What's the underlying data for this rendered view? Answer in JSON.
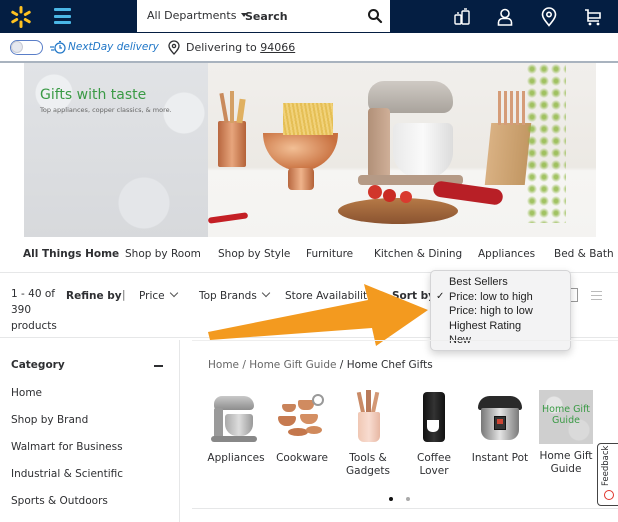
{
  "header": {
    "logo": "walmart-spark-icon",
    "menu_icon": "hamburger-menu-icon",
    "departments_label": "All Departments",
    "search_placeholder": "Search",
    "search_icon": "search-icon",
    "icons": [
      "reorder-icon",
      "account-icon",
      "store-locator-icon",
      "cart-icon"
    ],
    "colors": {
      "bar": "#041e42",
      "spark": "#ffc220",
      "menu": "#4bb7e6"
    }
  },
  "delivery": {
    "toggle_on": false,
    "nextday_label": "NextDay delivery",
    "delivering_label": "Delivering to",
    "zip": "94066"
  },
  "hero": {
    "title": "Gifts with taste",
    "subtitle": "Top appliances, copper classics, & more."
  },
  "category_nav": {
    "items": [
      {
        "label": "All Things Home",
        "active": true
      },
      {
        "label": "Shop by Room",
        "active": false
      },
      {
        "label": "Shop by Style",
        "active": false
      },
      {
        "label": "Furniture",
        "active": false
      },
      {
        "label": "Kitchen & Dining",
        "active": false
      },
      {
        "label": "Appliances",
        "active": false
      },
      {
        "label": "Bed & Bath",
        "active": false
      }
    ]
  },
  "refine": {
    "count_line1": "1 - 40 of",
    "count_line2": "390",
    "count_line3": "products",
    "refine_by": "Refine by",
    "separator": "|",
    "filters": [
      "Price",
      "Top Brands",
      "Store Availability"
    ],
    "sort_by": "Sort by"
  },
  "sort_dropdown": {
    "selected": "Price: low to high",
    "options": [
      "Best Sellers",
      "Price: low to high",
      "Price: high to low",
      "Highest Rating",
      "New"
    ],
    "check": "✓"
  },
  "sidebar": {
    "heading": "Category",
    "items": [
      "Home",
      "Shop by Brand",
      "Walmart for Business",
      "Industrial & Scientific",
      "Sports & Outdoors"
    ]
  },
  "breadcrumb": {
    "items": [
      "Home",
      "Home Gift Guide"
    ],
    "separator": "/",
    "current": "Home Chef Gifts"
  },
  "tiles": [
    {
      "label": "Appliances",
      "icon": "stand-mixer-image"
    },
    {
      "label": "Cookware",
      "icon": "copper-cookware-image"
    },
    {
      "label": "Tools & Gadgets",
      "icon": "copper-utensils-image"
    },
    {
      "label": "Coffee Lover",
      "icon": "coffee-maker-image"
    },
    {
      "label": "Instant Pot",
      "icon": "instant-pot-image"
    },
    {
      "label": "Home Gift Guide",
      "icon": "gift-guide-image",
      "image_text": "Home Gift Guide"
    }
  ],
  "carousel": {
    "pages": 2,
    "current": 1
  },
  "feedback": {
    "label": "Feedback"
  }
}
